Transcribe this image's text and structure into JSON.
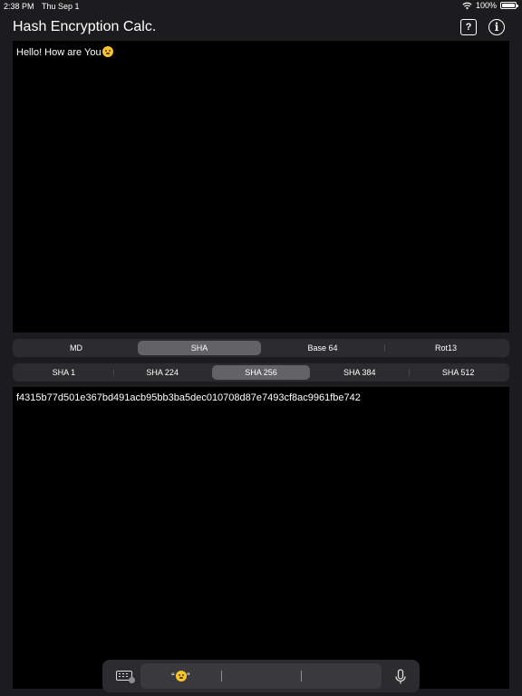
{
  "status_bar": {
    "time": "2:38 PM",
    "date": "Thu Sep 1",
    "battery_text": "100%",
    "battery_level": 1.0,
    "icons": [
      "wifi-icon",
      "battery-icon"
    ]
  },
  "nav": {
    "title": "Hash Encryption Calc.",
    "help_icon_glyph": "?",
    "info_icon_glyph": "i"
  },
  "input": {
    "text": "Hello! How are You",
    "emoji": "face-with-hand-over-mouth"
  },
  "algorithm_tabs": {
    "items": [
      "MD",
      "SHA",
      "Base 64",
      "Rot13"
    ],
    "selected": "SHA"
  },
  "sha_tabs": {
    "items": [
      "SHA 1",
      "SHA 224",
      "SHA 256",
      "SHA 384",
      "SHA 512"
    ],
    "selected": "SHA 256"
  },
  "output": {
    "text": "f4315b77d501e367bd491acb95bb3ba5dec010708d87e7493cf8ac9961fbe742"
  },
  "keyboard_bar": {
    "suggestion_open_quote": "“",
    "suggestion_close_quote": "”",
    "icons": [
      "keyboard-icon",
      "microphone-icon"
    ]
  },
  "colors": {
    "background": "#1c1c1e",
    "textbox": "#000000",
    "segment_bg": "#2c2c2e",
    "segment_selected": "#636366",
    "text": "#ffffff"
  }
}
